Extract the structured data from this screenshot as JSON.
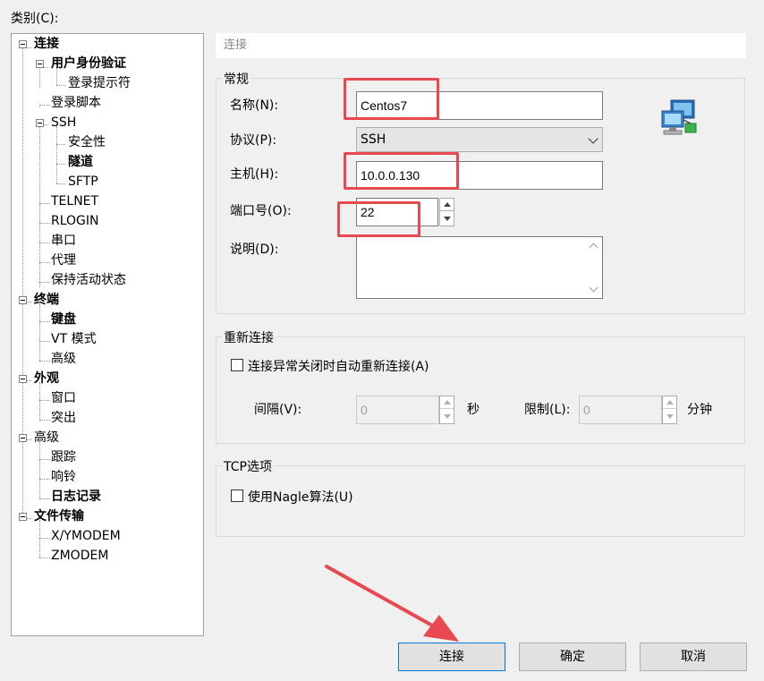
{
  "category_label": "类别(C):",
  "tree": [
    {
      "label": "连接",
      "bold": true
    },
    {
      "label": "用户身份验证",
      "bold": true
    },
    {
      "label": "登录提示符",
      "bold": false
    },
    {
      "label": "登录脚本",
      "bold": false
    },
    {
      "label": "SSH",
      "bold": false
    },
    {
      "label": "安全性",
      "bold": false
    },
    {
      "label": "隧道",
      "bold": true
    },
    {
      "label": "SFTP",
      "bold": false
    },
    {
      "label": "TELNET",
      "bold": false
    },
    {
      "label": "RLOGIN",
      "bold": false
    },
    {
      "label": "串口",
      "bold": false
    },
    {
      "label": "代理",
      "bold": false
    },
    {
      "label": "保持活动状态",
      "bold": false
    },
    {
      "label": "终端",
      "bold": true
    },
    {
      "label": "键盘",
      "bold": true
    },
    {
      "label": "VT 模式",
      "bold": false
    },
    {
      "label": "高级",
      "bold": false
    },
    {
      "label": "外观",
      "bold": true
    },
    {
      "label": "窗口",
      "bold": false
    },
    {
      "label": "突出",
      "bold": false
    },
    {
      "label": "高级",
      "bold": false
    },
    {
      "label": "跟踪",
      "bold": false
    },
    {
      "label": "响铃",
      "bold": false
    },
    {
      "label": "日志记录",
      "bold": true
    },
    {
      "label": "文件传输",
      "bold": true
    },
    {
      "label": "X/YMODEM",
      "bold": false
    },
    {
      "label": "ZMODEM",
      "bold": false
    }
  ],
  "section_title": "连接",
  "general": {
    "title": "常规",
    "name_label": "名称(N):",
    "name_value": "Centos7",
    "protocol_label": "协议(P):",
    "protocol_value": "SSH",
    "host_label": "主机(H):",
    "host_value": "10.0.0.130",
    "port_label": "端口号(O):",
    "port_value": "22",
    "desc_label": "说明(D):"
  },
  "reconnect": {
    "title": "重新连接",
    "auto_label": "连接异常关闭时自动重新连接(A)",
    "interval_label": "间隔(V):",
    "interval_value": "0",
    "interval_unit": "秒",
    "limit_label": "限制(L):",
    "limit_value": "0",
    "limit_unit": "分钟"
  },
  "tcp": {
    "title": "TCP选项",
    "nagle_label": "使用Nagle算法(U)"
  },
  "buttons": {
    "connect": "连接",
    "ok": "确定",
    "cancel": "取消"
  },
  "colors": {
    "highlight": "#e8484f",
    "focus": "#0078d7"
  }
}
